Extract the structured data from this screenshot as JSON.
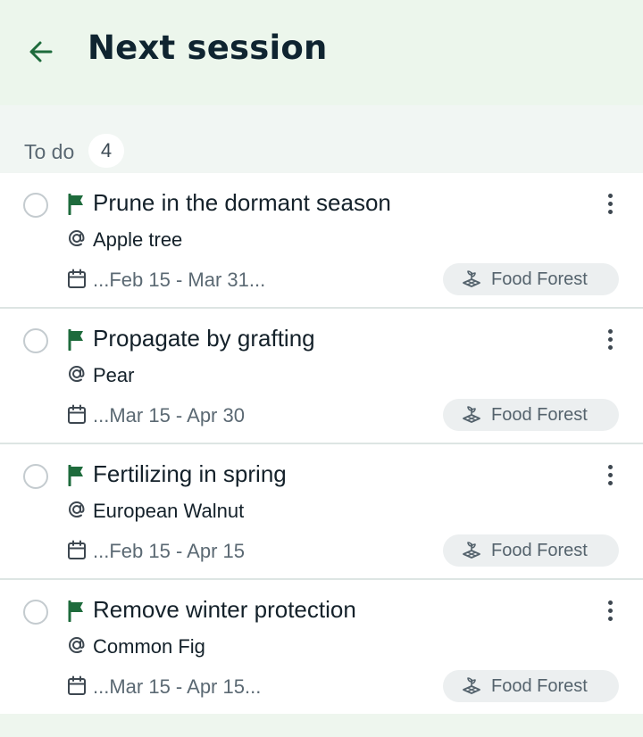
{
  "header": {
    "title": "Next session"
  },
  "section": {
    "label": "To do",
    "count": "4"
  },
  "tasks": [
    {
      "title": "Prune in the dormant season",
      "plant": "Apple tree",
      "dates": "...Feb 15 - Mar 31...",
      "garden": "Food Forest"
    },
    {
      "title": "Propagate by grafting",
      "plant": "Pear",
      "dates": "...Mar 15 - Apr 30",
      "garden": "Food Forest"
    },
    {
      "title": "Fertilizing in spring",
      "plant": "European Walnut",
      "dates": "...Feb 15 - Apr 15",
      "garden": "Food Forest"
    },
    {
      "title": "Remove winter protection",
      "plant": "Common Fig",
      "dates": "...Mar 15 - Apr 15...",
      "garden": "Food Forest"
    }
  ],
  "colors": {
    "accent": "#1e6b3c",
    "header_bg": "#ecf6ec",
    "text_primary": "#14212a",
    "text_secondary": "#5b6973"
  },
  "icons": {
    "back": "arrow-left-icon",
    "flag": "flag-icon",
    "at": "at-sign-icon",
    "calendar": "calendar-icon",
    "garden": "garden-plot-icon",
    "more": "more-vertical-icon",
    "check": "empty-circle-checkbox"
  }
}
